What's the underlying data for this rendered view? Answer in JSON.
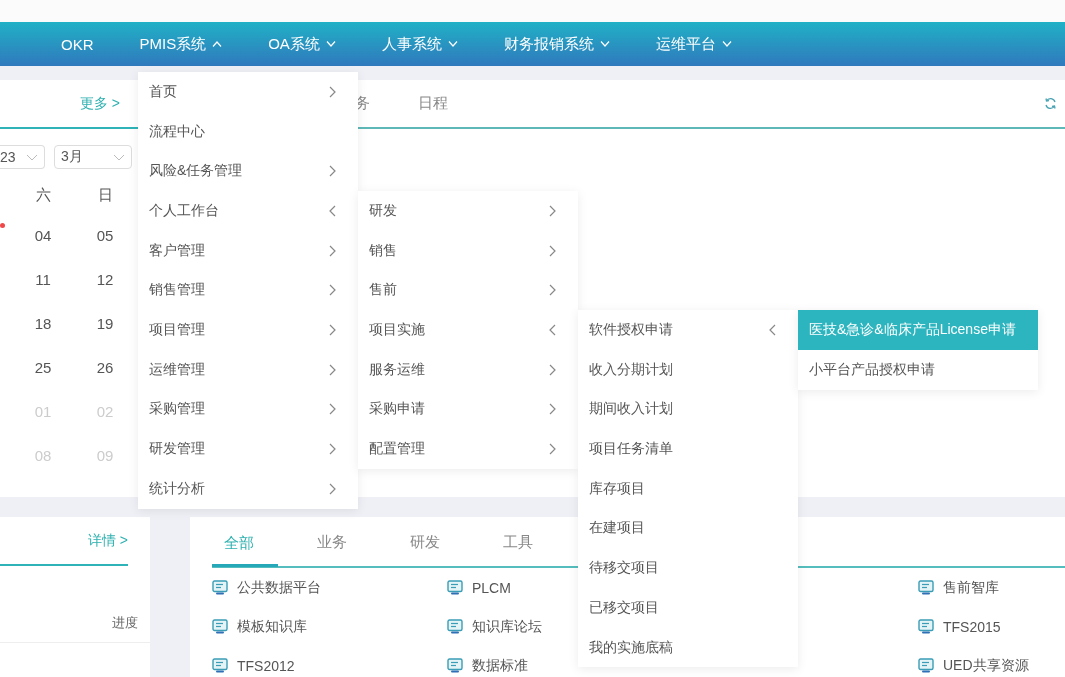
{
  "nav": {
    "items": [
      {
        "label": "OKR",
        "dropdown": false
      },
      {
        "label": "PMIS系统",
        "dropdown": true,
        "expanded": true,
        "menu": [
          {
            "label": "首页",
            "has_submenu": true,
            "expanded": false,
            "selected": false
          },
          {
            "label": "流程中心",
            "has_submenu": false,
            "expanded": false,
            "selected": false
          },
          {
            "label": "风险&任务管理",
            "has_submenu": true,
            "expanded": false,
            "selected": false
          },
          {
            "label": "个人工作台",
            "has_submenu": true,
            "expanded": true,
            "selected": false,
            "children": [
              {
                "label": "研发",
                "has_submenu": true,
                "expanded": false,
                "selected": false
              },
              {
                "label": "销售",
                "has_submenu": true,
                "expanded": false,
                "selected": false
              },
              {
                "label": "售前",
                "has_submenu": true,
                "expanded": false,
                "selected": false
              },
              {
                "label": "项目实施",
                "has_submenu": true,
                "expanded": true,
                "selected": false,
                "children": [
                  {
                    "label": "软件授权申请",
                    "has_submenu": true,
                    "expanded": true,
                    "selected": false,
                    "children": [
                      {
                        "label": "医技&急诊&临床产品License申请",
                        "has_submenu": false,
                        "expanded": false,
                        "selected": true
                      },
                      {
                        "label": "小平台产品授权申请",
                        "has_submenu": false,
                        "expanded": false,
                        "selected": false
                      }
                    ]
                  },
                  {
                    "label": "收入分期计划",
                    "has_submenu": false,
                    "expanded": false,
                    "selected": false
                  },
                  {
                    "label": "期间收入计划",
                    "has_submenu": false,
                    "expanded": false,
                    "selected": false
                  },
                  {
                    "label": "项目任务清单",
                    "has_submenu": false,
                    "expanded": false,
                    "selected": false
                  },
                  {
                    "label": "库存项目",
                    "has_submenu": false,
                    "expanded": false,
                    "selected": false
                  },
                  {
                    "label": "在建项目",
                    "has_submenu": false,
                    "expanded": false,
                    "selected": false
                  },
                  {
                    "label": "待移交项目",
                    "has_submenu": false,
                    "expanded": false,
                    "selected": false
                  },
                  {
                    "label": "已移交项目",
                    "has_submenu": false,
                    "expanded": false,
                    "selected": false
                  },
                  {
                    "label": "我的实施底稿",
                    "has_submenu": false,
                    "expanded": false,
                    "selected": false
                  }
                ]
              },
              {
                "label": "服务运维",
                "has_submenu": true,
                "expanded": false,
                "selected": false
              },
              {
                "label": "采购申请",
                "has_submenu": true,
                "expanded": false,
                "selected": false
              },
              {
                "label": "配置管理",
                "has_submenu": true,
                "expanded": false,
                "selected": false
              }
            ]
          },
          {
            "label": "客户管理",
            "has_submenu": true,
            "expanded": false,
            "selected": false
          },
          {
            "label": "销售管理",
            "has_submenu": true,
            "expanded": false,
            "selected": false
          },
          {
            "label": "项目管理",
            "has_submenu": true,
            "expanded": false,
            "selected": false
          },
          {
            "label": "运维管理",
            "has_submenu": true,
            "expanded": false,
            "selected": false
          },
          {
            "label": "采购管理",
            "has_submenu": true,
            "expanded": false,
            "selected": false
          },
          {
            "label": "研发管理",
            "has_submenu": true,
            "expanded": false,
            "selected": false
          },
          {
            "label": "统计分析",
            "has_submenu": true,
            "expanded": false,
            "selected": false
          }
        ]
      },
      {
        "label": "OA系统",
        "dropdown": true,
        "expanded": false
      },
      {
        "label": "人事系统",
        "dropdown": true,
        "expanded": false
      },
      {
        "label": "财务报销系统",
        "dropdown": true,
        "expanded": false
      },
      {
        "label": "运维平台",
        "dropdown": true,
        "expanded": false
      }
    ]
  },
  "calendar_card": {
    "more_link": "更多 >",
    "selects": [
      "23",
      "3月"
    ],
    "weekdays": [
      "六",
      "日"
    ],
    "weeks": [
      {
        "event_dot": true,
        "days": [
          {
            "label": "04",
            "muted": false
          },
          {
            "label": "05",
            "muted": false
          }
        ]
      },
      {
        "event_dot": false,
        "days": [
          {
            "label": "11",
            "muted": false
          },
          {
            "label": "12",
            "muted": false
          }
        ]
      },
      {
        "event_dot": false,
        "days": [
          {
            "label": "18",
            "muted": false
          },
          {
            "label": "19",
            "muted": false
          }
        ]
      },
      {
        "event_dot": false,
        "days": [
          {
            "label": "25",
            "muted": false
          },
          {
            "label": "26",
            "muted": false
          }
        ]
      },
      {
        "event_dot": false,
        "days": [
          {
            "label": "01",
            "muted": true
          },
          {
            "label": "02",
            "muted": true
          }
        ]
      },
      {
        "event_dot": false,
        "days": [
          {
            "label": "08",
            "muted": true
          },
          {
            "label": "09",
            "muted": true
          }
        ]
      }
    ]
  },
  "tasks_card": {
    "tabs": [
      {
        "label": "务",
        "selected": false
      },
      {
        "label": "日程",
        "selected": false
      }
    ]
  },
  "progress_card": {
    "details_link": "详情 >",
    "column_header": "进度"
  },
  "links_card": {
    "tabs": [
      {
        "label": "全部",
        "selected": true
      },
      {
        "label": "业务",
        "selected": false
      },
      {
        "label": "研发",
        "selected": false
      },
      {
        "label": "工具",
        "selected": false
      }
    ],
    "columns": [
      {
        "links": [
          "公共数据平台",
          "模板知识库",
          "TFS2012"
        ]
      },
      {
        "links": [
          "PLCM",
          "知识库论坛",
          "数据标准"
        ]
      },
      {
        "links": [
          "售前智库",
          "TFS2015",
          "UED共享资源"
        ]
      }
    ]
  }
}
